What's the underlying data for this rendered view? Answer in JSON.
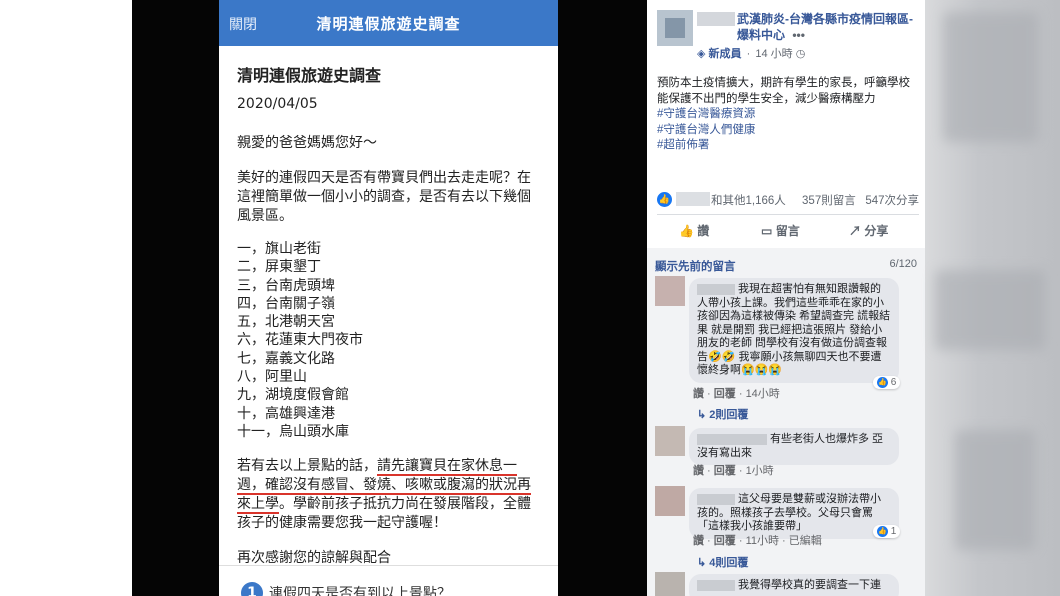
{
  "survey": {
    "close_label": "關閉",
    "header_title": "清明連假旅遊史調查",
    "title": "清明連假旅遊史調查",
    "date": "2020/04/05",
    "greeting": "親愛的爸爸媽媽您好～",
    "intro": "美好的連假四天是否有帶寶貝們出去走走呢？在這裡簡單做一個小小的調查，是否有去以下幾個風景區。",
    "places": [
      "一，旗山老街",
      "二，屏東墾丁",
      "三，台南虎頭埤",
      "四，台南關子嶺",
      "五，北港朝天宮",
      "六，花蓮東大門夜市",
      "七，嘉義文化路",
      "八，阿里山",
      "九，湖境度假會館",
      "十，高雄興達港",
      "十一，烏山頭水庫"
    ],
    "notice_prefix": "若有去以上景點的話，",
    "notice_underlined": "請先讓寶貝在家休息一週，確認沒有感冒、發燒、咳嗽或腹瀉的狀況再來上學",
    "notice_suffix": "。學齡前孩子抵抗力尚在發展階段，全體孩子的健康需要您我一起守護喔！",
    "thanks": "再次感謝您的諒解與配合",
    "question_number": "1",
    "question_text": "連假四天是否有到以上景點？"
  },
  "post": {
    "page_name": "武漢肺炎-台灣各縣市疫情回報區-爆料中心",
    "more_icon": "•••",
    "badge": "新成員",
    "time": "14 小時",
    "body": "預防本土疫情擴大，期許有學生的家長，呼籲學校能保護不出門的學生安全，減少醫療構壓力",
    "tags": [
      "#守護台灣醫療資源",
      "#守護台灣人們健康",
      "#超前佈署"
    ],
    "reactions_text": "和其他1,166人",
    "comments_count": "357則留言",
    "shares_count": "547次分享",
    "action_like": "讚",
    "action_comment": "留言",
    "action_share": "分享"
  },
  "comments": {
    "show_previous": "顯示先前的留言",
    "position": "6/120",
    "items": [
      {
        "text": "我現在超害怕有無知跟讚報的人帶小孩上課。我們這些乖乖在家的小孩卻因為這樣被傳染 希望調查完 謊報結果 就是開罰 我已經把這張照片 發給小朋友的老師 問學校有沒有做這份調查報告🤣🤣 我寧願小孩無聊四天也不要遭懷終身啊😭😭😭",
        "like": "讚",
        "reply": "回覆",
        "time": "14小時",
        "likes": "6",
        "replies": "2則回覆"
      },
      {
        "text": "有些老街人也爆炸多 亞沒有寫出來",
        "like": "讚",
        "reply": "回覆",
        "time": "1小時"
      },
      {
        "text": "這父母要是雙薪或沒辦法帶小孩的。照樣孩子去學校。父母只會罵「這樣我小孩誰要帶」",
        "like": "讚",
        "reply": "回覆",
        "time": "11小時",
        "edited": "已編輯",
        "likes": "1",
        "replies": "4則回覆"
      },
      {
        "text": "我覺得學校真的要調查一下連"
      }
    ]
  }
}
